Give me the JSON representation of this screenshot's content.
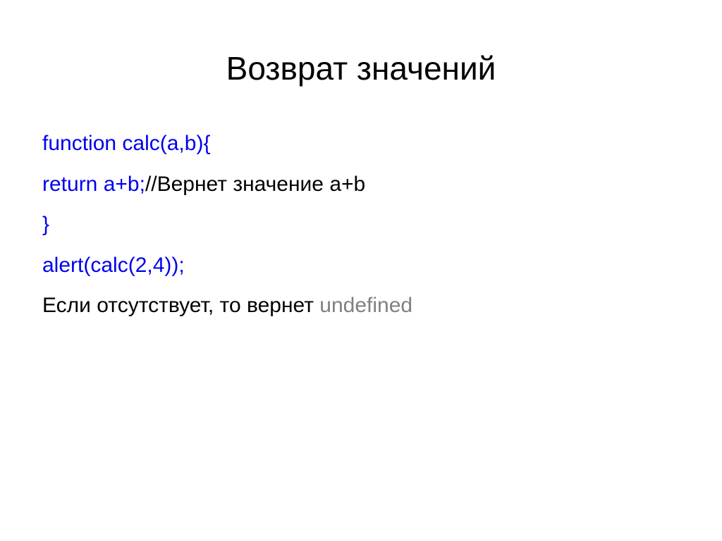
{
  "title": "Возврат значений",
  "lines": {
    "l1_blue": "function calc(a,b){",
    "l2_blue": "return a+b;",
    "l2_black": "//Вернет значение a+b",
    "l3_blue": "}",
    "l4_blue": "alert(calc(2,4));",
    "l5_black": "Если отсутствует, то вернет ",
    "l5_gray": "undefined"
  }
}
